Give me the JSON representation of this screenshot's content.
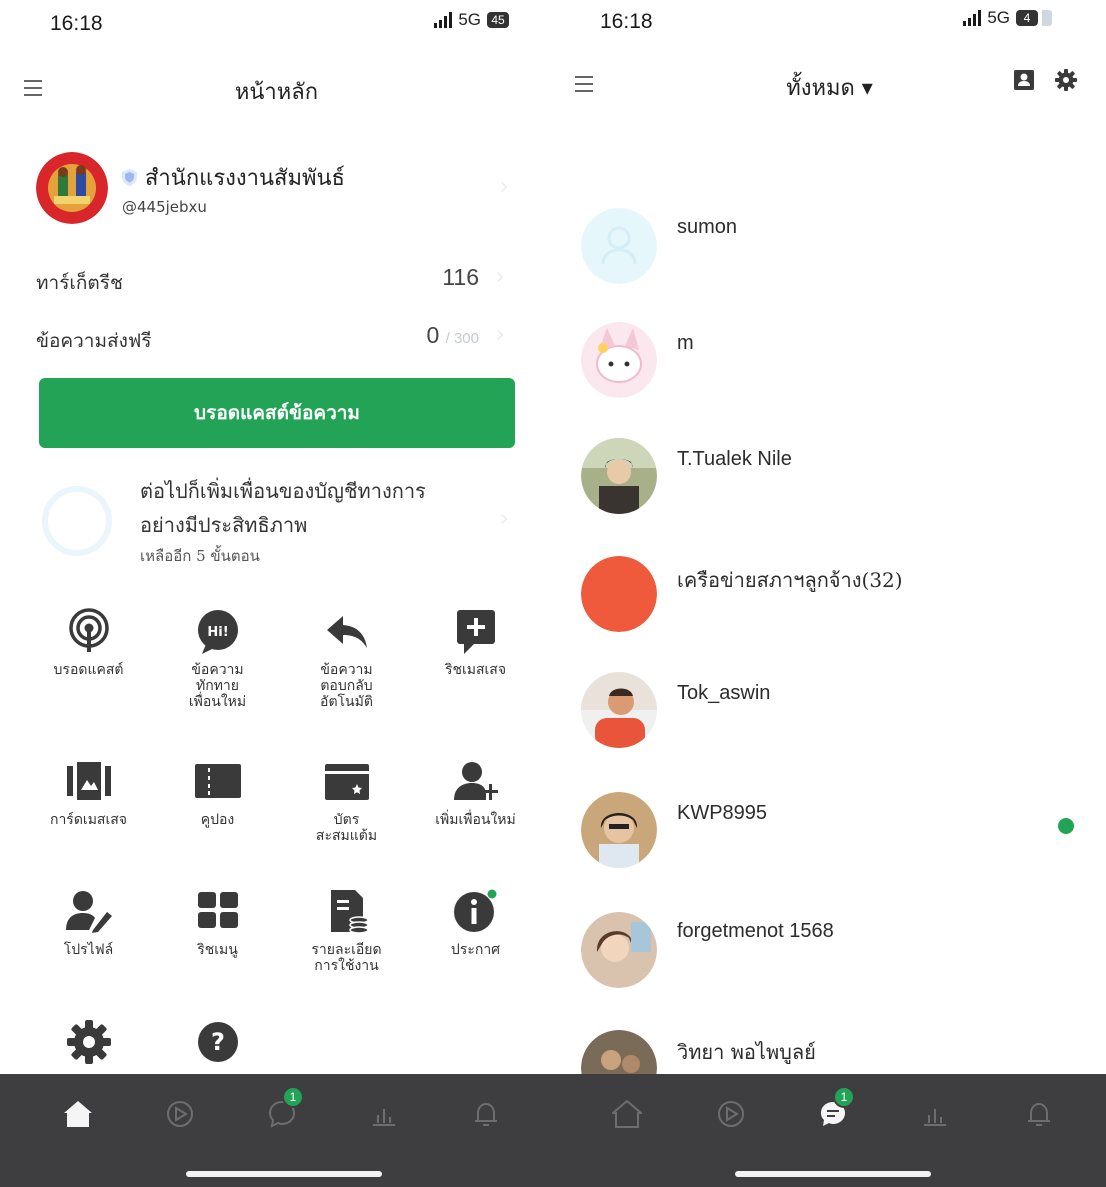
{
  "left_screen": {
    "status_bar": {
      "time": "16:18",
      "network": "5G",
      "battery": "45"
    },
    "nav": {
      "title": "หน้าหลัก"
    },
    "account": {
      "name": "สำนักแรงงานสัมพันธ์",
      "id": "@445jebxu"
    },
    "target_reach": {
      "label": "ทาร์เก็ตรีช",
      "value": "116"
    },
    "free_messages": {
      "label": "ข้อความส่งฟรี",
      "value": "0",
      "max": "/ 300"
    },
    "broadcast_button": "บรอดแคสต์ข้อความ",
    "onboarding": {
      "title": "ต่อไปก็เพิ่มเพื่อนของบัญชีทางการอย่างมีประสิทธิภาพ",
      "subtitle": "เหลืออีก 5 ขั้นตอน"
    },
    "menu": [
      {
        "label": "บรอดแคสต์",
        "icon": "broadcast-icon"
      },
      {
        "label": "ข้อความ\nทักทาย\nเพื่อนใหม่",
        "icon": "greeting-message-icon"
      },
      {
        "label": "ข้อความ\nตอบกลับ\nอัตโนมัติ",
        "icon": "auto-reply-icon"
      },
      {
        "label": "ริชเมสเสจ",
        "icon": "rich-message-icon"
      },
      {
        "label": "การ์ดเมสเสจ",
        "icon": "card-message-icon"
      },
      {
        "label": "คูปอง",
        "icon": "coupon-icon"
      },
      {
        "label": "บัตร\nสะสมแต้ม",
        "icon": "reward-card-icon"
      },
      {
        "label": "เพิ่มเพื่อนใหม่",
        "icon": "add-friend-icon"
      },
      {
        "label": "โปรไฟล์",
        "icon": "profile-icon"
      },
      {
        "label": "ริชเมนู",
        "icon": "rich-menu-icon"
      },
      {
        "label": "รายละเอียด\nการใช้งาน",
        "icon": "usage-details-icon"
      },
      {
        "label": "ประกาศ",
        "icon": "announcement-icon"
      },
      {
        "label": "",
        "icon": "settings-icon"
      },
      {
        "label": "",
        "icon": "help-icon"
      }
    ],
    "tabbar": {
      "chat_badge": "1"
    }
  },
  "right_screen": {
    "status_bar": {
      "time": "16:18",
      "network": "5G",
      "battery": "4"
    },
    "nav": {
      "title": "ทั้งหมด ▾"
    },
    "chats": [
      {
        "name": "sumon",
        "avatar_color": "#e6f7fb"
      },
      {
        "name": "m",
        "avatar_color": "#f4c6d6"
      },
      {
        "name": "T.Tualek Nile",
        "avatar_color": "#8a8f6a"
      },
      {
        "name": "เครือข่ายสภาฯลูกจ้าง(32)",
        "avatar_color": "#ef5a3c"
      },
      {
        "name": "Tok_aswin",
        "avatar_color": "#e8553a"
      },
      {
        "name": "KWP8995",
        "avatar_color": "#c9a77a",
        "unread": true
      },
      {
        "name": "forgetmenot 1568",
        "avatar_color": "#d9b8a0"
      },
      {
        "name": "วิทยา พอไพบูลย์",
        "avatar_color": "#7a6a58"
      }
    ],
    "tabbar": {
      "chat_badge": "1"
    }
  },
  "colors": {
    "brand_green": "#22a355",
    "tabbar_bg": "#3e3e40"
  }
}
